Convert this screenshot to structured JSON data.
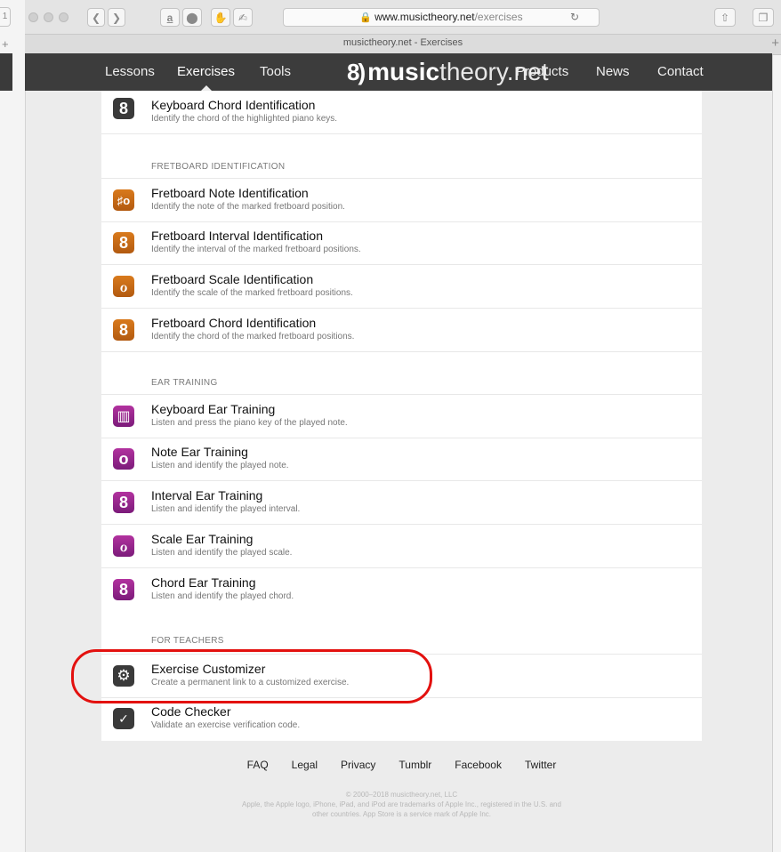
{
  "browser": {
    "url_domain": "www.musictheory.net",
    "url_path": "/exercises",
    "tab_title": "musictheory.net - Exercises",
    "amazon_icon": "a",
    "left_stub": "1"
  },
  "nav": {
    "lessons": "Lessons",
    "exercises": "Exercises",
    "tools": "Tools",
    "logo_mark": "8)",
    "logo_bold": "music",
    "logo_light": "theory.net",
    "products": "Products",
    "news": "News",
    "contact": "Contact"
  },
  "exercises": {
    "keyboard_chord": {
      "icon": "8",
      "title": "Keyboard Chord Identification",
      "desc": "Identify the chord of the highlighted piano keys."
    },
    "fretboard_section": "FRETBOARD IDENTIFICATION",
    "fretboard": [
      {
        "icon": "♯o",
        "title": "Fretboard Note Identification",
        "desc": "Identify the note of the marked fretboard position."
      },
      {
        "icon": "8",
        "title": "Fretboard Interval Identification",
        "desc": "Identify the interval of the marked fretboard positions."
      },
      {
        "icon": "ℴ",
        "title": "Fretboard Scale Identification",
        "desc": "Identify the scale of the marked fretboard positions."
      },
      {
        "icon": "8",
        "title": "Fretboard Chord Identification",
        "desc": "Identify the chord of the marked fretboard positions."
      }
    ],
    "ear_section": "EAR TRAINING",
    "ear": [
      {
        "icon": "▥",
        "title": "Keyboard Ear Training",
        "desc": "Listen and press the piano key of the played note."
      },
      {
        "icon": "o",
        "title": "Note Ear Training",
        "desc": "Listen and identify the played note."
      },
      {
        "icon": "8",
        "title": "Interval Ear Training",
        "desc": "Listen and identify the played interval."
      },
      {
        "icon": "ℴ",
        "title": "Scale Ear Training",
        "desc": "Listen and identify the played scale."
      },
      {
        "icon": "8",
        "title": "Chord Ear Training",
        "desc": "Listen and identify the played chord."
      }
    ],
    "teachers_section": "FOR TEACHERS",
    "teachers": [
      {
        "icon": "⚙",
        "title": "Exercise Customizer",
        "desc": "Create a permanent link to a customized exercise."
      },
      {
        "icon": "✓",
        "title": "Code Checker",
        "desc": "Validate an exercise verification code."
      }
    ]
  },
  "footer": {
    "links": [
      "FAQ",
      "Legal",
      "Privacy",
      "Tumblr",
      "Facebook",
      "Twitter"
    ],
    "copyright": "© 2000–2018 musictheory.net, LLC",
    "legal": "Apple, the Apple logo, iPhone, iPad, and iPod are trademarks of Apple Inc., registered in the U.S. and other countries. App Store is a service mark of Apple Inc."
  },
  "colors": {
    "nav_bg": "#3c3c3c",
    "orange_icon": "#c4691a",
    "purple_icon": "#952a8e",
    "annotation": "#e3110f"
  }
}
